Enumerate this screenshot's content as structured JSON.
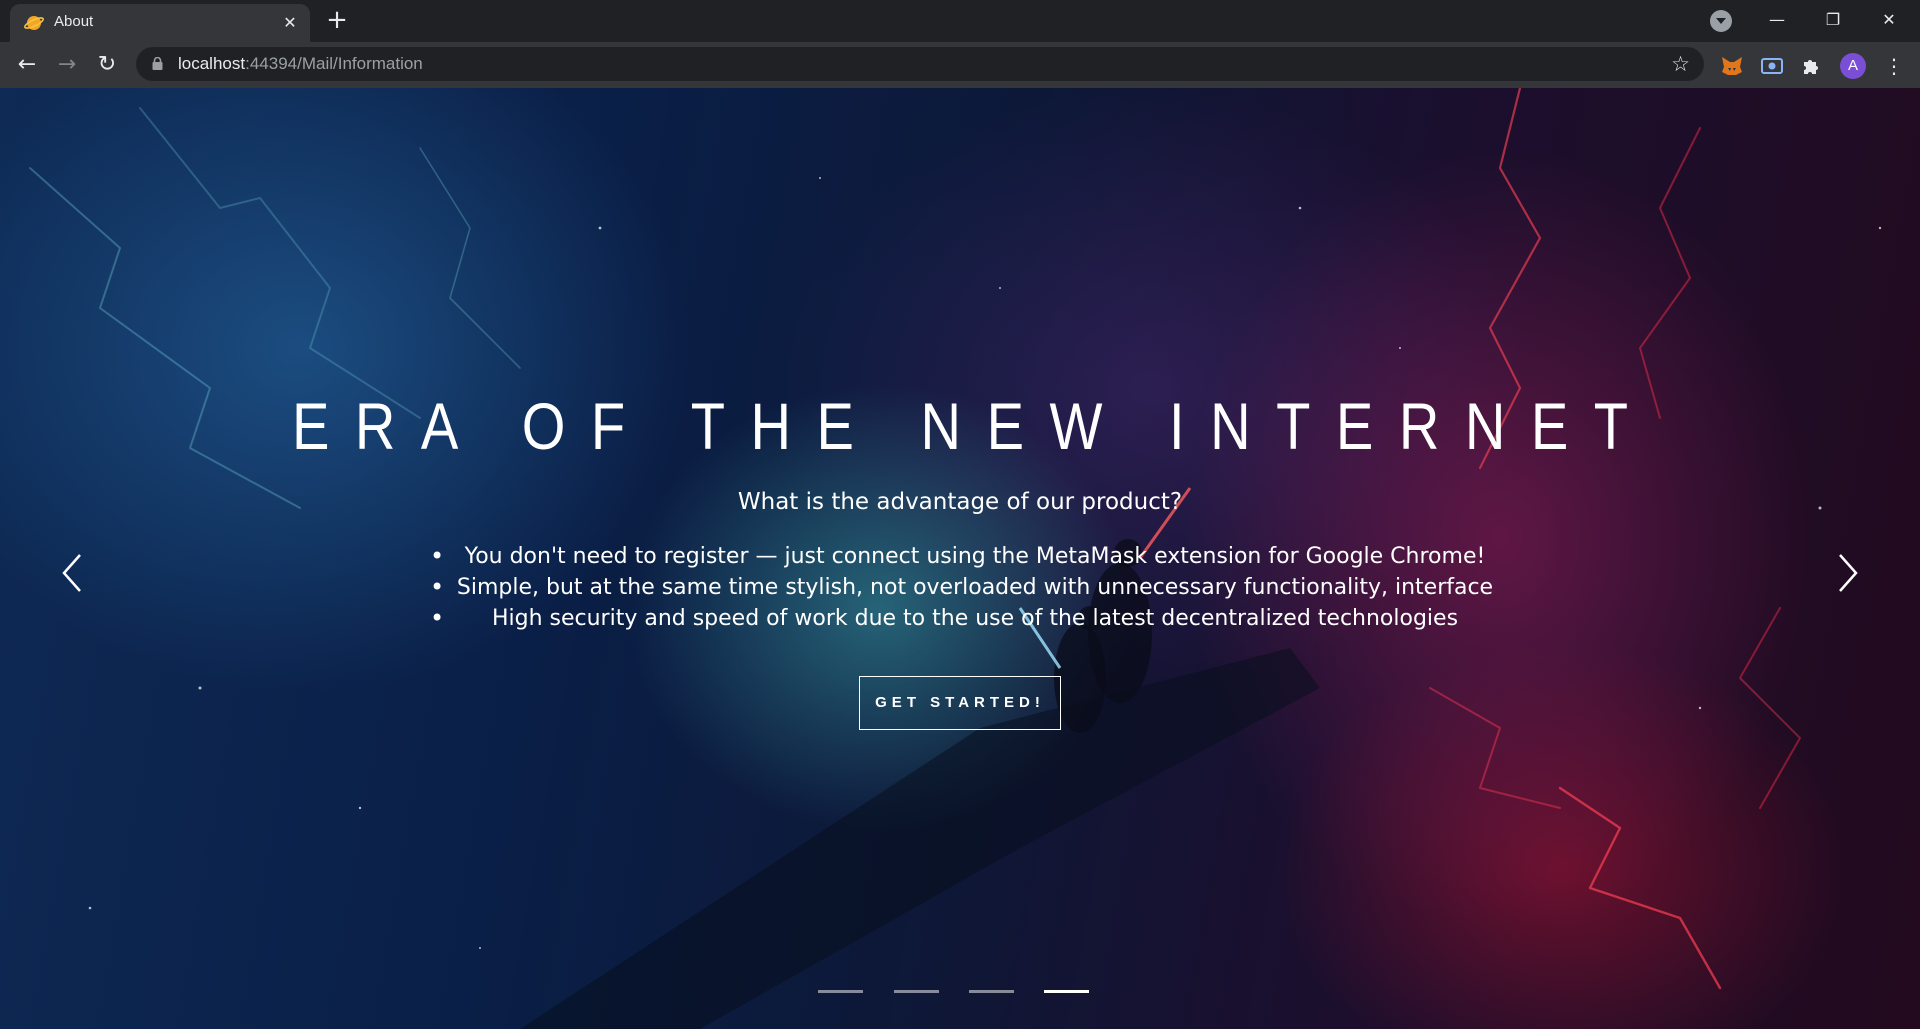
{
  "browser": {
    "tab": {
      "title": "About",
      "favicon": "planet-icon",
      "close_icon": "close-icon"
    },
    "new_tab_icon": "plus-icon",
    "window_controls": {
      "minimize": "minimize-icon",
      "restore": "restore-icon",
      "close": "close-icon"
    },
    "nav": {
      "back": "back-arrow-icon",
      "forward": "forward-arrow-icon",
      "reload": "reload-icon"
    },
    "address": {
      "host": "localhost",
      "path": ":44394/Mail/Information",
      "lock_icon": "lock-icon",
      "bookmark_icon": "star-icon"
    },
    "extensions": [
      "metamask-fox-icon",
      "screencast-icon",
      "puzzle-piece-icon"
    ],
    "profile_initial": "A",
    "menu_icon": "kebab-menu-icon"
  },
  "hero": {
    "title": "ERA OF THE NEW INTERNET",
    "subtitle": "What is the advantage of our product?",
    "features": [
      "You don't need to register — just connect using the MetaMask extension for Google Chrome!",
      "Simple, but at the same time stylish, not overloaded with unnecessary functionality, interface",
      "High security and speed of work due to the use of the latest decentralized technologies"
    ],
    "cta_label": "GET STARTED!",
    "prev_icon": "chevron-left-icon",
    "next_icon": "chevron-right-icon",
    "slides_total": 4,
    "active_slide": 4
  },
  "colors": {
    "chrome_dark": "#202124",
    "chrome_toolbar": "#35363a",
    "avatar_purple": "#7a4fd6",
    "hero_blue": "#0e2a55",
    "hero_red": "#c81432"
  }
}
